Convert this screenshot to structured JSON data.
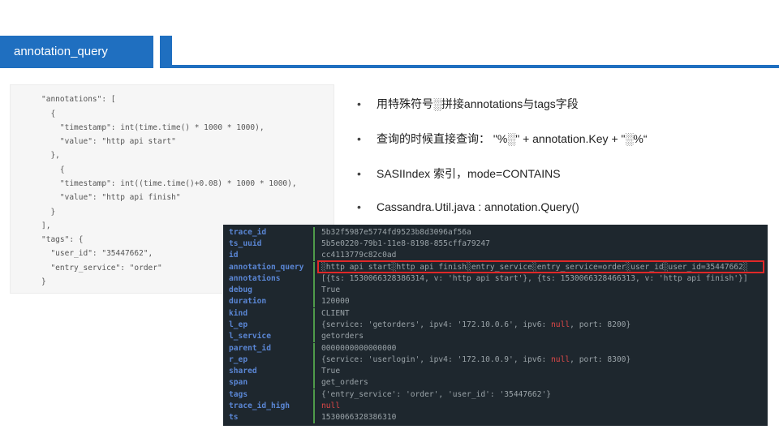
{
  "title": {
    "label": "annotation_query"
  },
  "code": {
    "lines": [
      {
        "t": "\"annotations\": ["
      },
      {
        "t": "  {"
      },
      {
        "t": "    \"timestamp\": int(time.time() * 1000 * 1000),"
      },
      {
        "t": "    \"value\": \"http api start\""
      },
      {
        "t": "  },"
      },
      {
        "t": "    {"
      },
      {
        "t": "    \"timestamp\": int((time.time()+0.08) * 1000 * 1000),"
      },
      {
        "t": "    \"value\": \"http api finish\""
      },
      {
        "t": "  }"
      },
      {
        "t": "],"
      },
      {
        "t": "\"tags\": {"
      },
      {
        "t": "  \"user_id\": \"35447662\","
      },
      {
        "t": "  \"entry_service\": \"order\""
      },
      {
        "t": "}"
      }
    ]
  },
  "bullets": [
    {
      "marker": "•",
      "text": "用特殊符号░拼接annotations与tags字段"
    },
    {
      "marker": "•",
      "text": "查询的时候直接查询： \"%░\" + annotation.Key + \"░%“"
    },
    {
      "marker": "•",
      "text": "SASIIndex 索引，mode=CONTAINS"
    },
    {
      "marker": "•",
      "text": "Cassandra.Util.java : annotation.Query()"
    }
  ],
  "terminal": {
    "rows": [
      {
        "key": "trace_id",
        "value": "5b32f5987e5774fd9523b8d3096af56a"
      },
      {
        "key": "ts_uuid",
        "value": "5b5e0220-79b1-11e8-8198-855cffa79247"
      },
      {
        "key": "id",
        "value": "cc4113779c82c0ad"
      },
      {
        "key": "annotation_query",
        "value": "░http api start░http api finish░entry_service░entry_service=order░user_id░user_id=35447662░"
      },
      {
        "key": "annotations",
        "value": "[{ts: 1530066328386314, v: 'http api start'}, {ts: 1530066328466313, v: 'http api finish'}]"
      },
      {
        "key": "debug",
        "value": "True"
      },
      {
        "key": "duration",
        "value": "120000"
      },
      {
        "key": "kind",
        "value": "CLIENT"
      },
      {
        "key": "l_ep",
        "value_a": "{service: 'getorders', ipv4: '172.10.0.6', ipv6: ",
        "null": "null",
        "value_b": ", port: 8200}"
      },
      {
        "key": "l_service",
        "value": "getorders"
      },
      {
        "key": "parent_id",
        "value": "0000000000000000"
      },
      {
        "key": "r_ep",
        "value_a": "{service: 'userlogin', ipv4: '172.10.0.9', ipv6: ",
        "null": "null",
        "value_b": ", port: 8300}"
      },
      {
        "key": "shared",
        "value": "True"
      },
      {
        "key": "span",
        "value": "get_orders"
      },
      {
        "key": "tags",
        "value": "{'entry_service': 'order', 'user_id': '35447662'}"
      },
      {
        "key": "trace_id_high",
        "null": "null"
      },
      {
        "key": "ts",
        "value": "1530066328386310"
      }
    ]
  }
}
